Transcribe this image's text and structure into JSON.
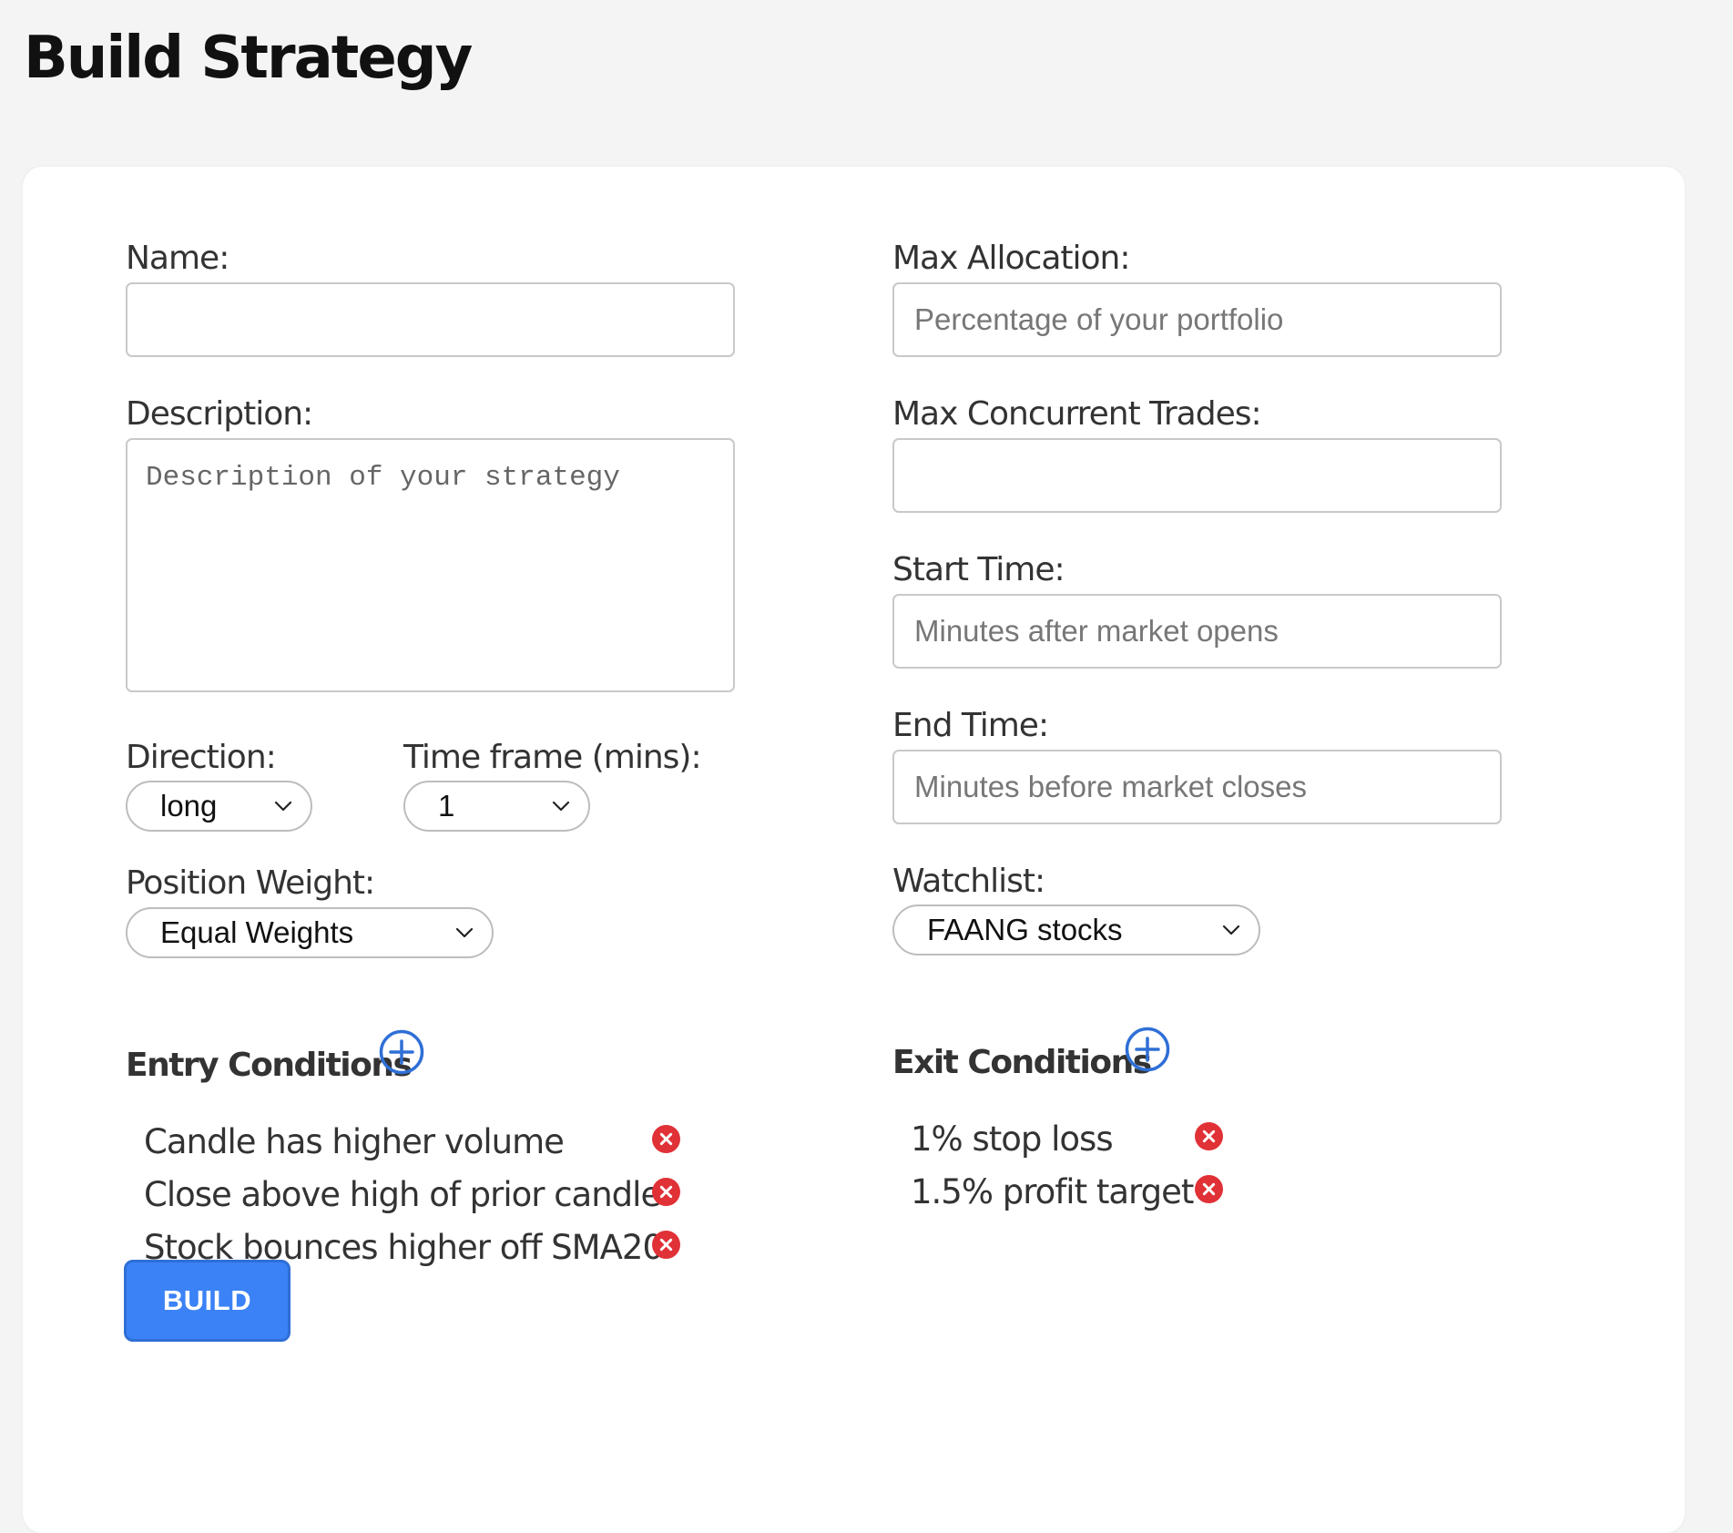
{
  "page": {
    "title": "Build Strategy"
  },
  "form": {
    "name": {
      "label": "Name:",
      "value": "",
      "placeholder": ""
    },
    "description": {
      "label": "Description:",
      "value": "",
      "placeholder": "Description of your strategy"
    },
    "direction": {
      "label": "Direction:",
      "selected": "long"
    },
    "time_frame": {
      "label": "Time frame (mins):",
      "selected": "1"
    },
    "position_weight": {
      "label": "Position Weight:",
      "selected": "Equal Weights"
    },
    "max_allocation": {
      "label": "Max Allocation:",
      "value": "",
      "placeholder": "Percentage of your portfolio"
    },
    "max_concurrent_trades": {
      "label": "Max Concurrent Trades:",
      "value": "",
      "placeholder": ""
    },
    "start_time": {
      "label": "Start Time:",
      "value": "",
      "placeholder": "Minutes after market opens"
    },
    "end_time": {
      "label": "End Time:",
      "value": "",
      "placeholder": "Minutes before market closes"
    },
    "watchlist": {
      "label": "Watchlist:",
      "selected": "FAANG stocks"
    }
  },
  "entry_conditions": {
    "title": "Entry Conditions",
    "items": [
      "Candle has higher volume",
      "Close above high of prior candle",
      "Stock bounces higher off SMA20"
    ]
  },
  "exit_conditions": {
    "title": "Exit Conditions",
    "items": [
      "1% stop loss",
      "1.5% profit target"
    ]
  },
  "actions": {
    "build_label": "BUILD"
  },
  "icons": {
    "add": "plus-circle-icon",
    "remove": "x-circle-icon",
    "dropdown": "chevron-down-icon"
  },
  "colors": {
    "accent": "#3b82f6",
    "add_icon": "#2f6fd6",
    "remove_icon": "#e03137",
    "background": "#f4f4f5",
    "card": "#ffffff"
  }
}
